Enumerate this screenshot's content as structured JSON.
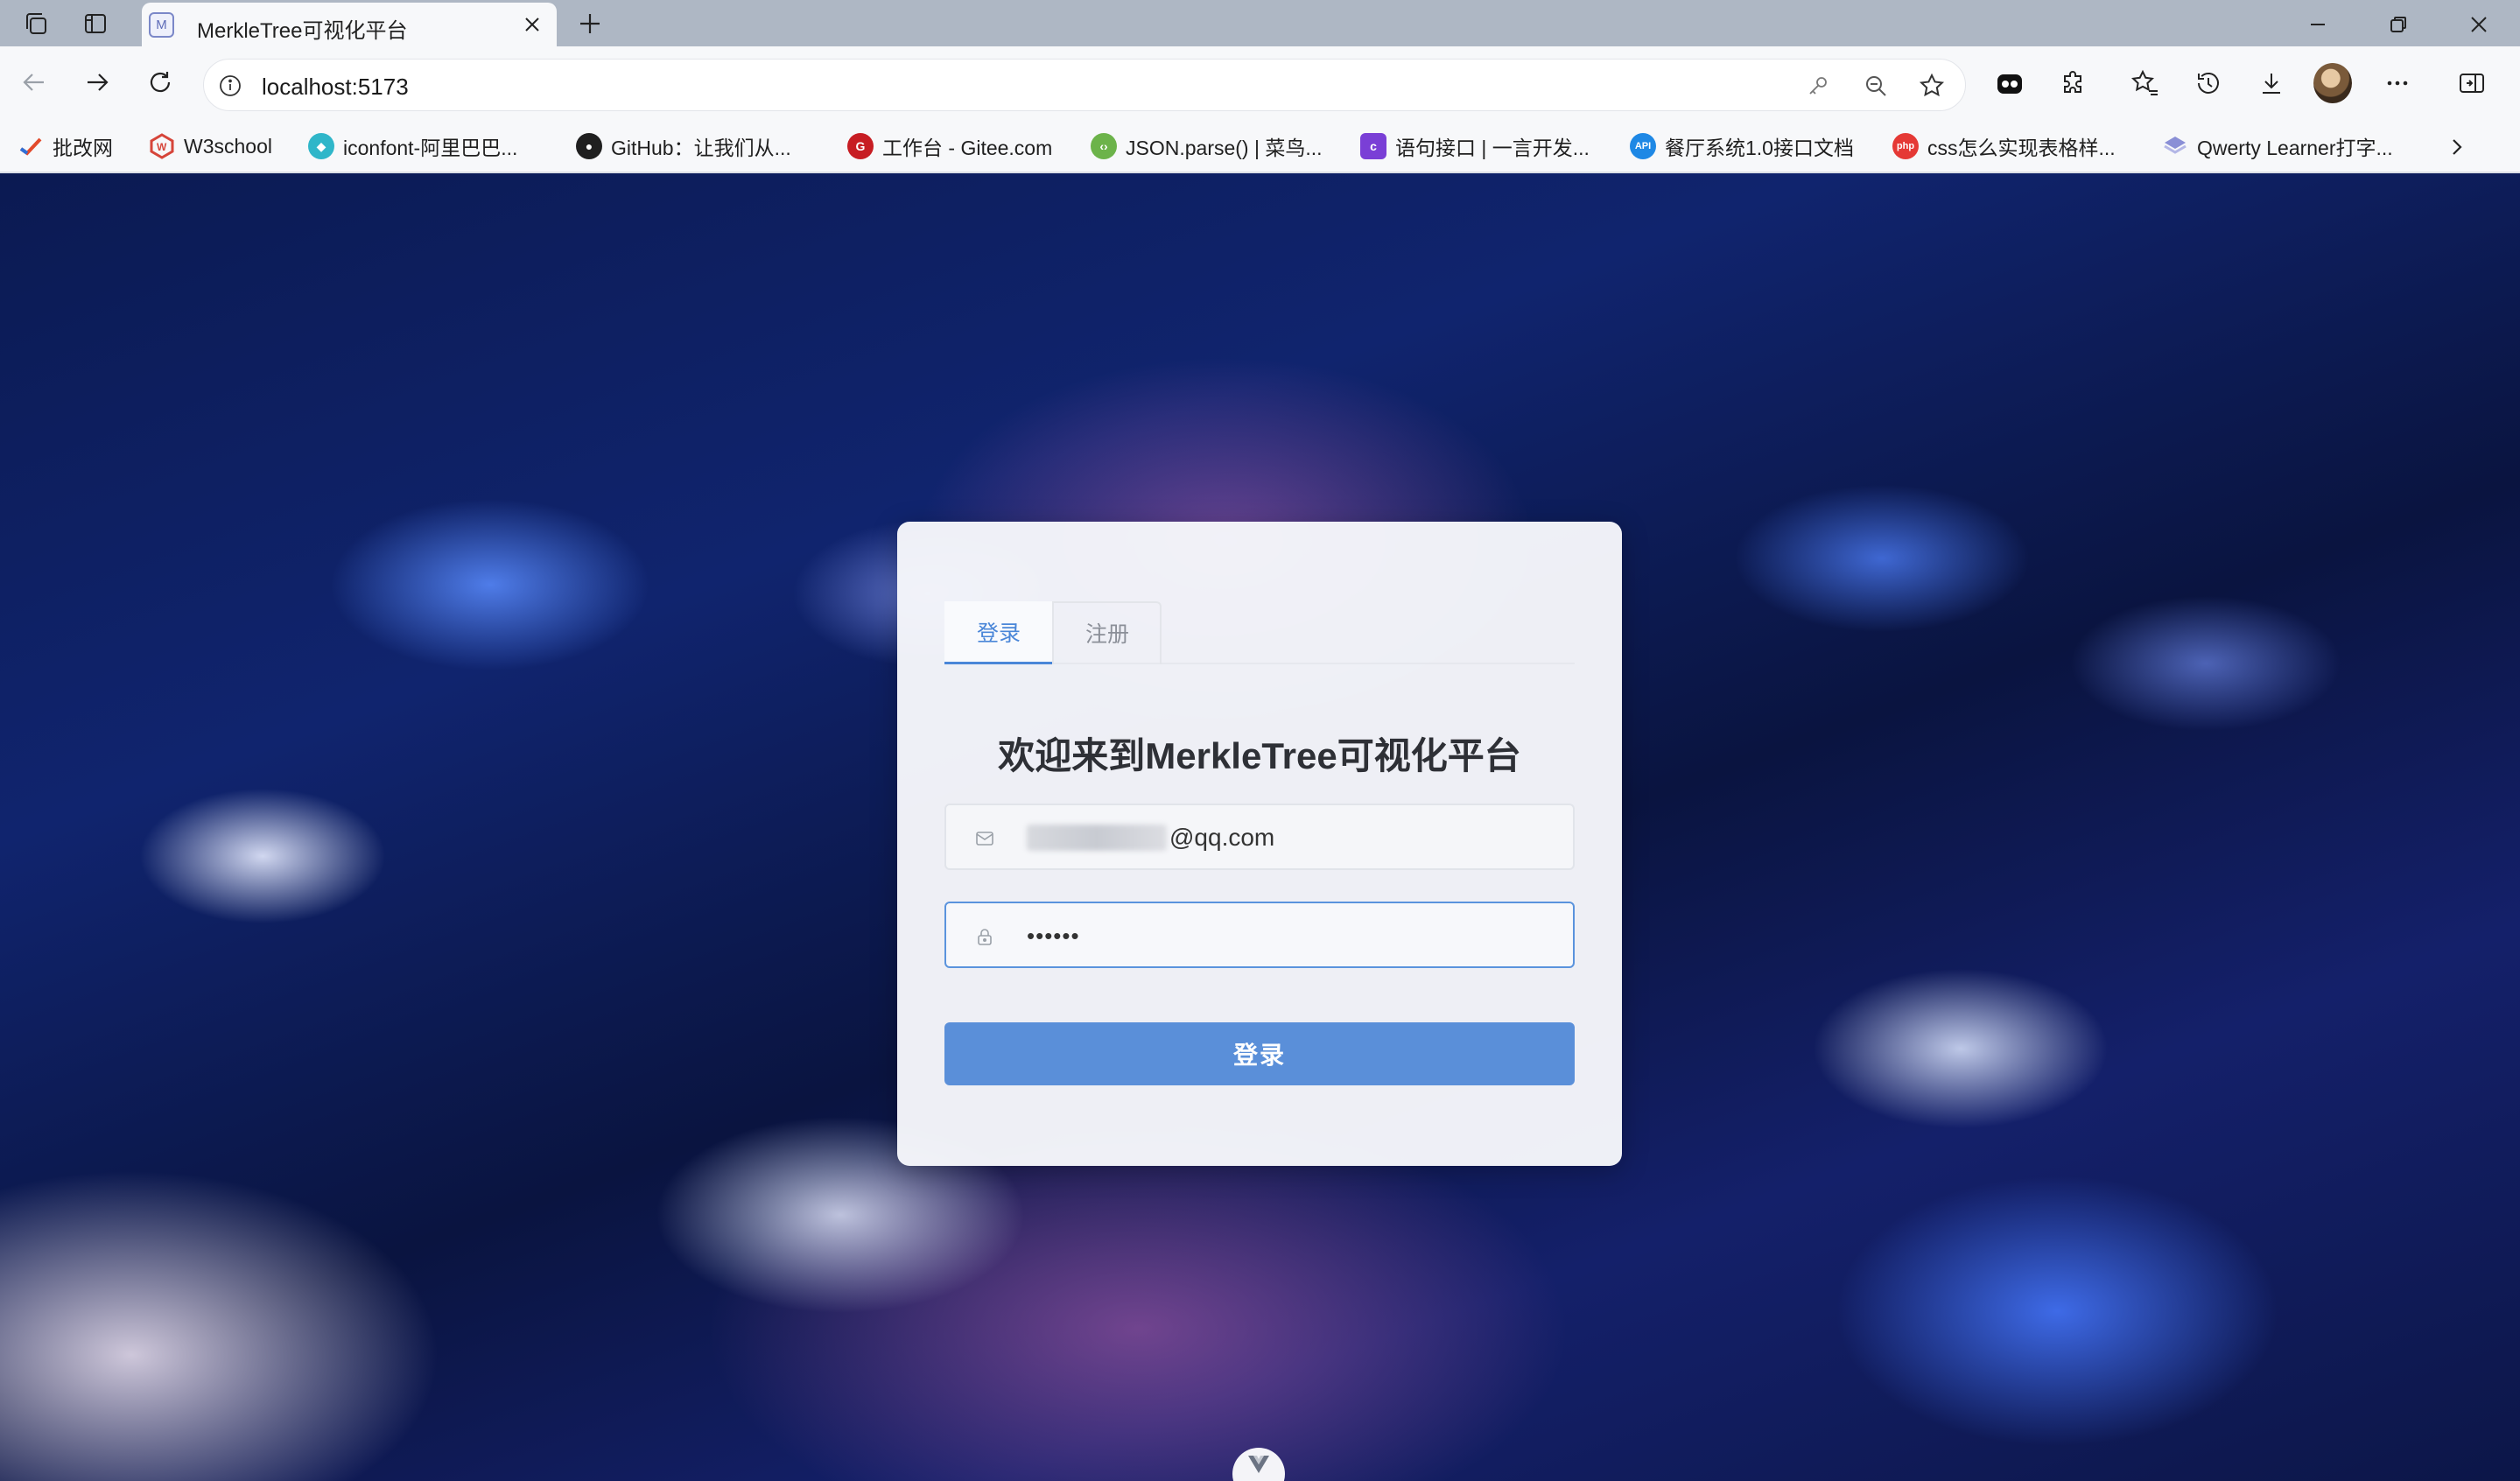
{
  "browser": {
    "tab_title": "MerkleTree可视化平台",
    "tab_favicon": "M",
    "url": "localhost:5173"
  },
  "bookmarks": [
    {
      "label": "批改网",
      "icon": "pigai-icon",
      "color": "#e24a2b"
    },
    {
      "label": "W3school",
      "icon": "w3school-icon",
      "color": "#d6453a"
    },
    {
      "label": "iconfont-阿里巴巴...",
      "icon": "iconfont-icon",
      "color": "#2fb6c9"
    },
    {
      "label": "GitHub：让我们从...",
      "icon": "github-icon",
      "color": "#1f1f1f"
    },
    {
      "label": "工作台 - Gitee.com",
      "icon": "gitee-icon",
      "color": "#c71d23"
    },
    {
      "label": "JSON.parse() | 菜鸟...",
      "icon": "runoob-icon",
      "color": "#6cb34a"
    },
    {
      "label": "语句接口 | 一言开发...",
      "icon": "hitokoto-icon",
      "color": "#7a3fd6"
    },
    {
      "label": "餐厅系统1.0接口文档",
      "icon": "api-icon",
      "color": "#1e88e5"
    },
    {
      "label": "css怎么实现表格样...",
      "icon": "php-icon",
      "color": "#e53935"
    },
    {
      "label": "Qwerty Learner打字...",
      "icon": "qwerty-icon",
      "color": "#8a8fd6"
    }
  ],
  "login": {
    "tabs": [
      {
        "label": "登录",
        "active": true
      },
      {
        "label": "注册",
        "active": false
      }
    ],
    "welcome": "欢迎来到MerkleTree可视化平台",
    "email_value": "@qq.com",
    "password_value": "••••••",
    "submit_label": "登录"
  },
  "colors": {
    "accent": "#4a86d8",
    "button": "#5a8fd9"
  }
}
